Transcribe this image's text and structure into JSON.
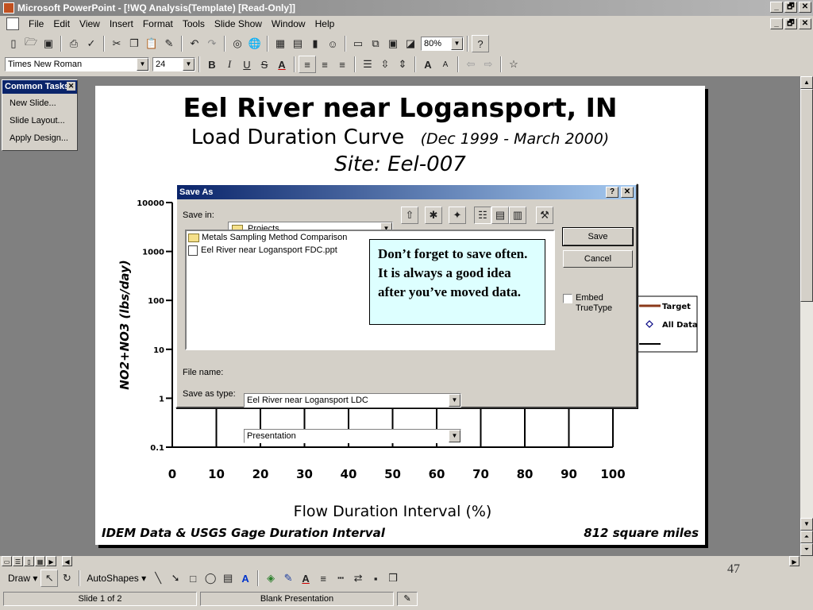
{
  "app": {
    "title": "Microsoft PowerPoint - [!WQ Analysis(Template) [Read-Only]]",
    "window_controls": [
      "_",
      "🗗",
      "✕"
    ]
  },
  "menu": [
    "File",
    "Edit",
    "View",
    "Insert",
    "Format",
    "Tools",
    "Slide Show",
    "Window",
    "Help"
  ],
  "toolbar": {
    "zoom": "80%",
    "font": "Times New Roman",
    "size": "24",
    "bold": "B",
    "italic": "I",
    "underline": "U",
    "shadow": "S",
    "font_color": "A"
  },
  "task_pane": {
    "title": "Common Tasks",
    "items": [
      "New Slide...",
      "Slide Layout...",
      "Apply Design..."
    ]
  },
  "slide": {
    "title": "Eel River near Logansport, IN",
    "subtitle": "Load Duration Curve",
    "subtitle_range": "(Dec 1999 - March 2000)",
    "site": "Site:  Eel-007",
    "footer_left": "IDEM Data & USGS Gage Duration Interval",
    "footer_right": "812 square miles"
  },
  "chart_data": {
    "type": "scatter",
    "ylabel": "NO2+NO3 (lbs/day)",
    "xlabel": "Flow Duration Interval (%)",
    "x_ticks": [
      "0",
      "10",
      "20",
      "30",
      "40",
      "50",
      "60",
      "70",
      "80",
      "90",
      "100"
    ],
    "y_ticks": [
      "10000",
      "1000",
      "100",
      "10",
      "1",
      "0.1"
    ],
    "xlim": [
      0,
      100
    ],
    "ylim": [
      0.1,
      10000
    ],
    "y_scale": "log",
    "legend": {
      "placement": "right",
      "entries": [
        "Target",
        "All Data"
      ]
    },
    "series": [
      {
        "name": "Target"
      },
      {
        "name": "All Data"
      }
    ],
    "colors": {
      "target": "#8b3a1a",
      "all_data": "#000080"
    }
  },
  "dialog": {
    "title": "Save As",
    "help_btn": "?",
    "close_btn": "✕",
    "save_in_label": "Save in:",
    "save_in_value": "Projects",
    "files": [
      {
        "name": "Metals Sampling Method Comparison",
        "type": "folder"
      },
      {
        "name": "Eel River near Logansport FDC.ppt",
        "type": "ppt"
      }
    ],
    "callout": "Don’t forget to save often.  It is always a good idea after you’ve moved data.",
    "file_name_label": "File name:",
    "file_name_value": "Eel River near Logansport LDC",
    "save_type_label": "Save as type:",
    "save_type_value": "Presentation",
    "save_btn": "Save",
    "cancel_btn": "Cancel",
    "embed_label": "Embed TrueType"
  },
  "drawing_toolbar": {
    "draw": "Draw",
    "autoshapes": "AutoShapes"
  },
  "status": {
    "slide": "Slide 1 of 2",
    "template": "Blank Presentation"
  },
  "page_number": "47"
}
